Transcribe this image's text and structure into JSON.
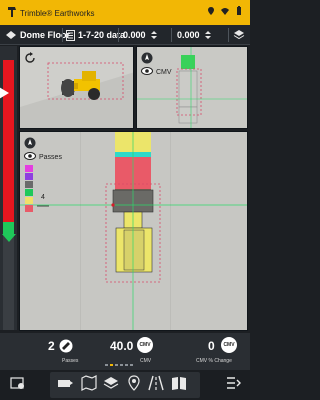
{
  "statusbar": {
    "app_title": "Trimble® Earthworks",
    "icons": [
      "trimble-logo",
      "location-icon",
      "wifi-icon",
      "battery-icon"
    ]
  },
  "toolbar": {
    "surface_name": "Dome Floor",
    "dataset_name": "1-7-20 data",
    "value_left": "0.000",
    "value_right": "0.000",
    "icons": [
      "surface-icon",
      "dataset-icon",
      "cut-fill-icon",
      "elevation-icon",
      "layers-icon"
    ]
  },
  "views": {
    "top_left": {
      "icons": [
        "refresh-icon",
        "roller-compactor-icon"
      ]
    },
    "top_right": {
      "mode_label": "CMV",
      "icons": [
        "compass-icon",
        "eye-icon"
      ]
    },
    "main": {
      "mode_label": "Passes",
      "legend_count": "4",
      "legend_colors": [
        "#e43ee0",
        "#8e3fe0",
        "#6a6a6a",
        "#1fc85a",
        "#f0e06a",
        "#e95a68"
      ],
      "icons": [
        "compass-icon",
        "eye-icon"
      ]
    }
  },
  "stats": {
    "passes": {
      "value": "2",
      "label": "Passes"
    },
    "cmv": {
      "value": "40.0",
      "label": "CMV"
    },
    "cmv_change": {
      "value": "0",
      "label": "CMV % Change"
    }
  },
  "page_indicator": {
    "pages": 6,
    "active": 1
  },
  "bottom_nav": {
    "items": [
      "settings-icon",
      "mapping-icon",
      "map-icon",
      "layers-icon",
      "location-pin-icon",
      "road-icon",
      "book-icon",
      "more-icon"
    ]
  },
  "colors": {
    "accent": "#f2b705",
    "grade_red": "#e6161f",
    "grade_green": "#1fc85a",
    "compacted_yellow": "#ece56a",
    "machine_teal": "#2fd9c9"
  }
}
